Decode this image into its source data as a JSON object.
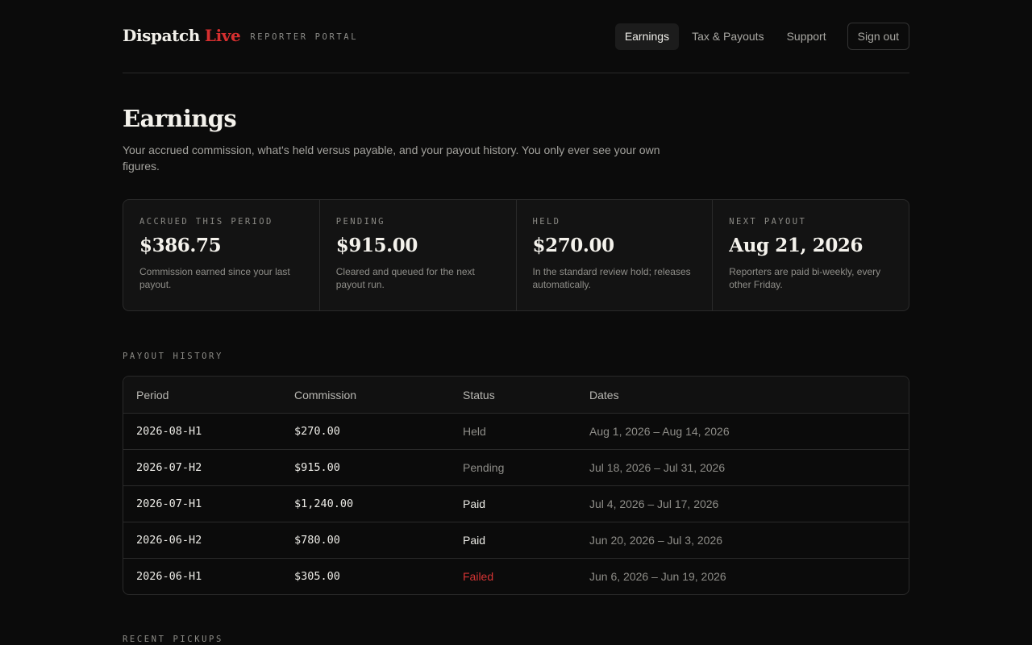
{
  "header": {
    "brand_name": "Dispatch",
    "brand_accent": "Live",
    "brand_sub": "REPORTER PORTAL",
    "nav": [
      {
        "label": "Earnings",
        "active": true
      },
      {
        "label": "Tax & Payouts",
        "active": false
      },
      {
        "label": "Support",
        "active": false
      }
    ],
    "signout_label": "Sign out"
  },
  "page": {
    "title": "Earnings",
    "description": "Your accrued commission, what's held versus payable, and your payout history. You only ever see your own figures."
  },
  "stats": [
    {
      "label": "ACCRUED THIS PERIOD",
      "value": "$386.75",
      "note": "Commission earned since your last payout."
    },
    {
      "label": "PENDING",
      "value": "$915.00",
      "note": "Cleared and queued for the next payout run."
    },
    {
      "label": "HELD",
      "value": "$270.00",
      "note": "In the standard review hold; releases automatically."
    },
    {
      "label": "NEXT PAYOUT",
      "value": "Aug 21, 2026",
      "note": "Reporters are paid bi-weekly, every other Friday."
    }
  ],
  "payout_history": {
    "label": "PAYOUT HISTORY",
    "columns": [
      "Period",
      "Commission",
      "Status",
      "Dates"
    ],
    "rows": [
      {
        "period": "2026-08-H1",
        "commission": "$270.00",
        "status": "Held",
        "dates": "Aug 1, 2026 – Aug 14, 2026"
      },
      {
        "period": "2026-07-H2",
        "commission": "$915.00",
        "status": "Pending",
        "dates": "Jul 18, 2026 – Jul 31, 2026"
      },
      {
        "period": "2026-07-H1",
        "commission": "$1,240.00",
        "status": "Paid",
        "dates": "Jul 4, 2026 – Jul 17, 2026"
      },
      {
        "period": "2026-06-H2",
        "commission": "$780.00",
        "status": "Paid",
        "dates": "Jun 20, 2026 – Jul 3, 2026"
      },
      {
        "period": "2026-06-H1",
        "commission": "$305.00",
        "status": "Failed",
        "dates": "Jun 6, 2026 – Jun 19, 2026"
      }
    ]
  },
  "recent_pickups": {
    "label": "RECENT PICKUPS"
  },
  "colors": {
    "background": "#0b0b0b",
    "accent_red": "#d62f2f",
    "failed_red": "#d63434",
    "muted_text": "#8e8d88"
  }
}
